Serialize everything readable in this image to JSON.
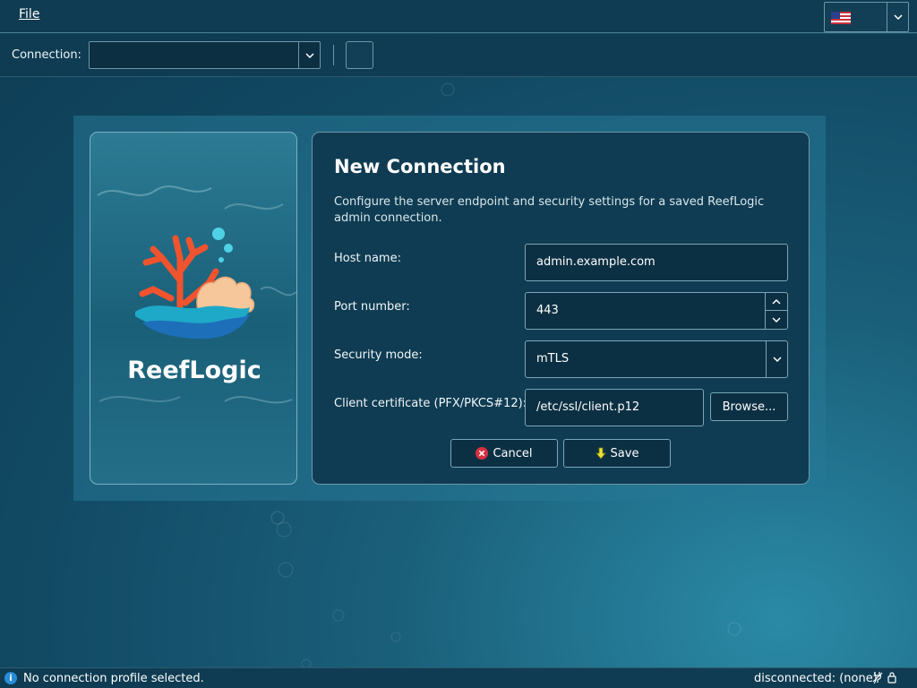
{
  "menubar": {
    "file_label": "File",
    "language_icon": "us-flag-icon"
  },
  "toolbar": {
    "connection_label": "Connection:",
    "connection_value": ""
  },
  "brand": {
    "name": "ReefLogic",
    "logo_icon": "coral-reef-logo"
  },
  "form": {
    "title": "New Connection",
    "description": "Configure the server endpoint and security settings for a saved ReefLogic admin connection.",
    "host_label": "Host name:",
    "host_value": "admin.example.com",
    "port_label": "Port number:",
    "port_value": "443",
    "security_label": "Security mode:",
    "security_value": "mTLS",
    "cert_label": "Client certificate (PFX/PKCS#12):",
    "cert_value": "/etc/ssl/client.p12",
    "browse_label": "Browse...",
    "cancel_label": "Cancel",
    "save_label": "Save"
  },
  "status": {
    "message": "No connection profile selected.",
    "connection_state": "disconnected: (none)",
    "icons": [
      "info-icon",
      "plug-icon",
      "lock-icon"
    ]
  },
  "colors": {
    "accent": "#0f3c52",
    "border": "#7aa6b8",
    "cancel_icon": "#d63040",
    "save_icon": "#e8e23a"
  }
}
